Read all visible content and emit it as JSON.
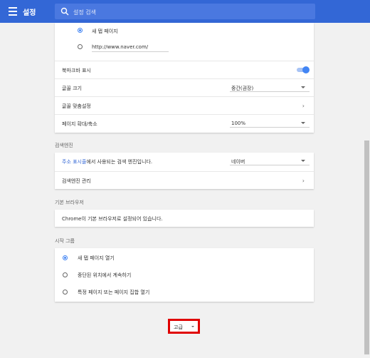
{
  "header": {
    "title": "설정",
    "search_placeholder": "설정 검색"
  },
  "startup_top": {
    "option_new_tab": "새 탭 페이지",
    "homepage_url": "http://www.naver.com/"
  },
  "appearance": {
    "bookmark_bar_label": "북마크바 표시",
    "bookmark_bar_on": true,
    "font_size_label": "글꼴 크기",
    "font_size_value": "중간(권장)",
    "customize_fonts_label": "글꼴 맞춤설정",
    "page_zoom_label": "페이지 확대/축소",
    "page_zoom_value": "100%"
  },
  "search_engine": {
    "section_title": "검색엔진",
    "desc_link": "주소 표시줄",
    "desc_rest": "에서 사용되는 검색 엔진입니다.",
    "engine_value": "네이버",
    "manage_label": "검색엔진 관리"
  },
  "default_browser": {
    "section_title": "기본 브라우저",
    "status": "Chrome이 기본 브라우저로 설정되어 있습니다."
  },
  "on_startup": {
    "section_title": "시작 그룹",
    "options": [
      "새 탭 페이지 열기",
      "중단된 위치에서 계속하기",
      "특정 페이지 또는 페이지 집합 열기"
    ],
    "selected_index": 0
  },
  "advanced": {
    "label": "고급"
  },
  "colors": {
    "accent": "#3367d6",
    "highlight_border": "#e00000"
  }
}
